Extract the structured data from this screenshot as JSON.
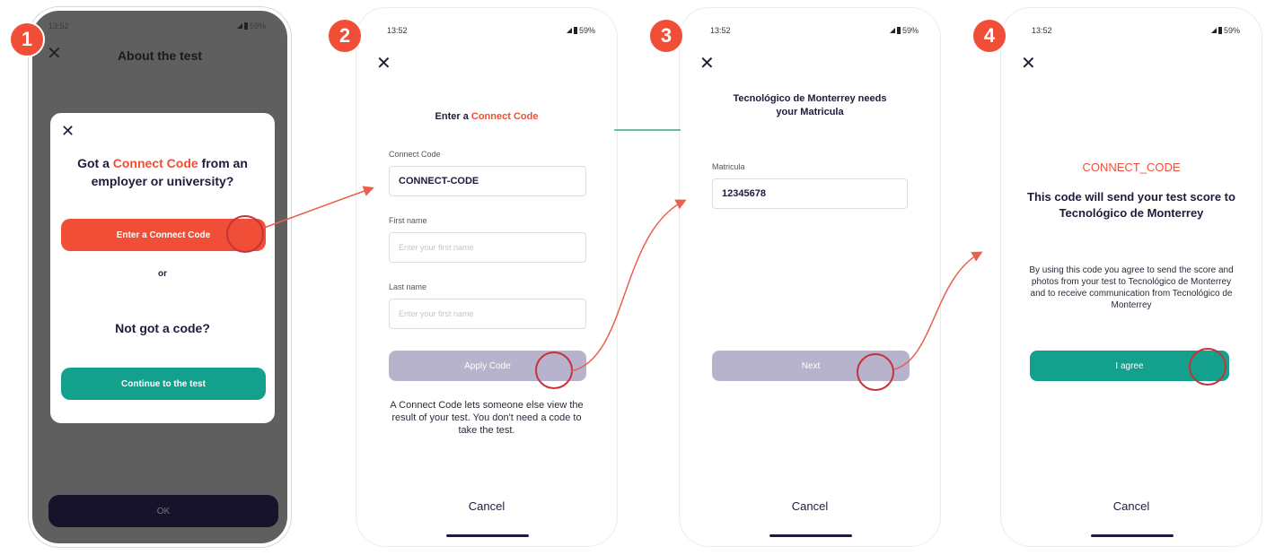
{
  "steps": [
    "1",
    "2",
    "3",
    "4"
  ],
  "screen1": {
    "time": "13:52",
    "status_right": "59%",
    "title": "About the test",
    "modal": {
      "q_part1": "Got a ",
      "q_accent": "Connect Code",
      "q_part2": " from an employer or university?",
      "enter_button": "Enter a Connect Code",
      "or": "or",
      "not_got": "Not got a code?",
      "continue_button": "Continue to the test"
    },
    "ok_button": "OK"
  },
  "screen2": {
    "time": "13:52",
    "battery": "59%",
    "heading_part1": "Enter a ",
    "heading_accent": "Connect Code",
    "fields": {
      "connect_label": "Connect Code",
      "connect_value": "CONNECT-CODE",
      "first_label": "First name",
      "first_placeholder": "Enter your first name",
      "last_label": "Last name",
      "last_placeholder": "Enter your first name"
    },
    "apply_button": "Apply Code",
    "note": "A Connect Code lets someone else view the result of your test. You don't need a code to take the test.",
    "cancel": "Cancel"
  },
  "screen3": {
    "time": "13:52",
    "battery": "59%",
    "heading": "Tecnológico de Monterrey needs your Matricula",
    "label": "Matricula",
    "value": "12345678",
    "next_button": "Next",
    "cancel": "Cancel"
  },
  "screen4": {
    "time": "13:52",
    "battery": "59%",
    "code": "CONNECT_CODE",
    "heading": "This code will send your test score to Tecnológico de Monterrey",
    "text": "By using this code you agree to send the score and photos from your test to Tecnológico de Monterrey and to receive communication from Tecnológico de Monterrey",
    "agree_button": "I agree",
    "cancel": "Cancel"
  },
  "colors": {
    "accent": "#f04e37",
    "teal": "#13a08d",
    "navy": "#1e1b3a",
    "disabled": "#b7b3cc"
  }
}
